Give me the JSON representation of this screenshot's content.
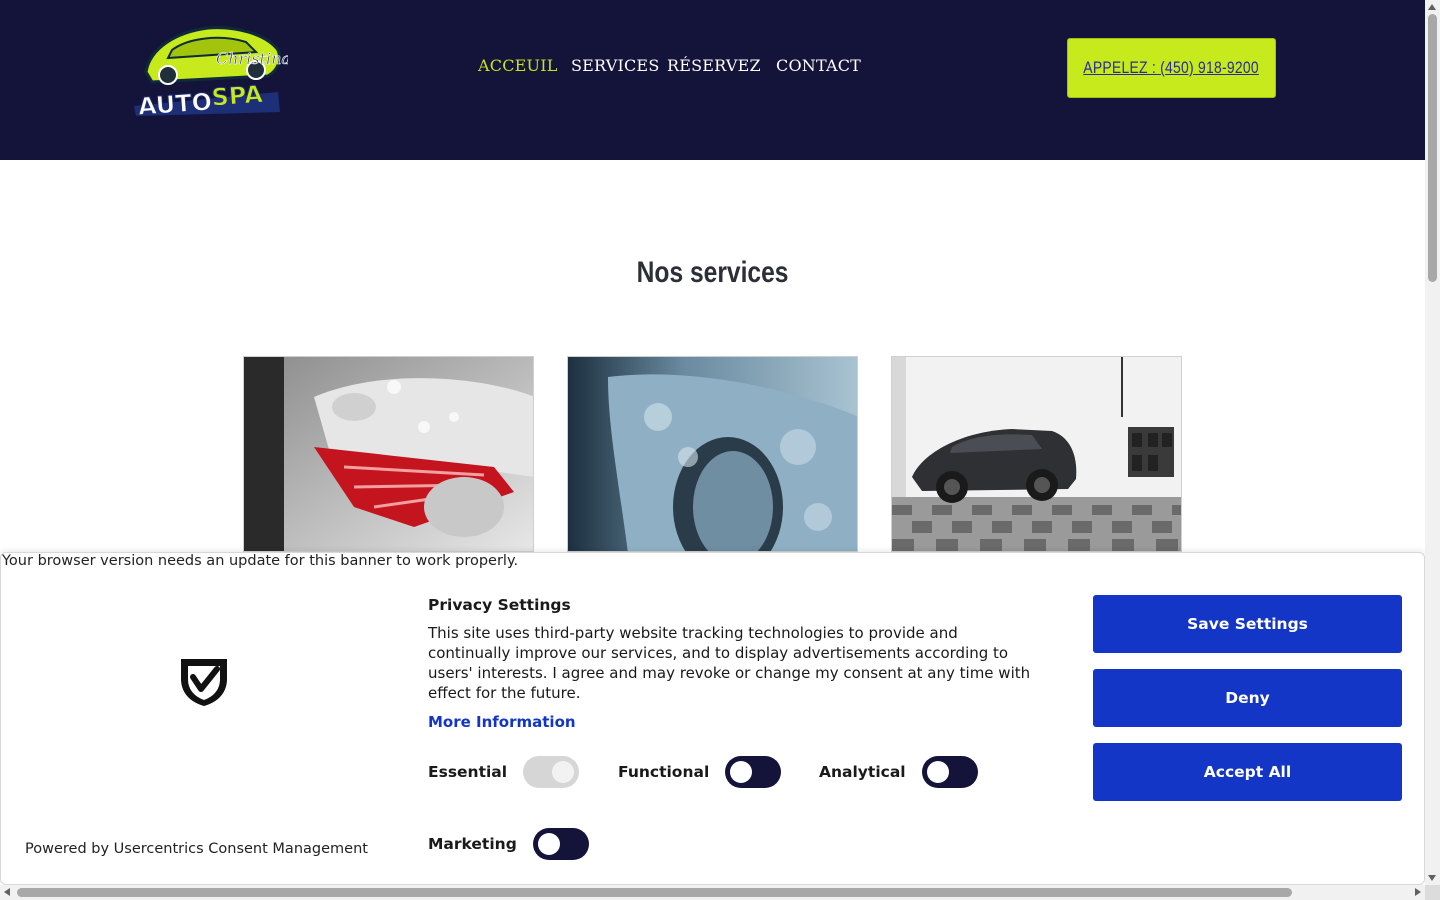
{
  "header": {
    "logo": {
      "script": "Christina",
      "text": "AUTOSPA"
    },
    "nav": [
      {
        "label": "ACCEUIL",
        "active": true
      },
      {
        "label": "SERVICES",
        "active": false
      },
      {
        "label": "RÉSERVEZ",
        "active": false
      },
      {
        "label": "CONTACT",
        "active": false
      }
    ],
    "call_button": "APPELEZ : (450) 918-9200"
  },
  "services": {
    "title": "Nos services"
  },
  "consent": {
    "browser_note": "Your browser version needs an update for this banner to work properly.",
    "title": "Privacy Settings",
    "body": "This site uses third-party website tracking technologies to provide and continually improve our services, and to display advertisements according to users' interests. I agree and may revoke or change my consent at any time with effect for the future.",
    "more_info": "More Information",
    "toggles": {
      "essential": {
        "label": "Essential",
        "on": true,
        "disabled": true
      },
      "functional": {
        "label": "Functional",
        "on": false
      },
      "analytical": {
        "label": "Analytical",
        "on": false
      },
      "marketing": {
        "label": "Marketing",
        "on": false
      }
    },
    "buttons": {
      "save": "Save Settings",
      "deny": "Deny",
      "accept": "Accept All"
    },
    "powered_by": "Powered by Usercentrics Consent Management",
    "icons": {
      "shield": "shield-check-icon"
    }
  },
  "colors": {
    "header_bg": "#14143a",
    "accent": "#c6ea1c",
    "consent_blue": "#1436c6"
  }
}
